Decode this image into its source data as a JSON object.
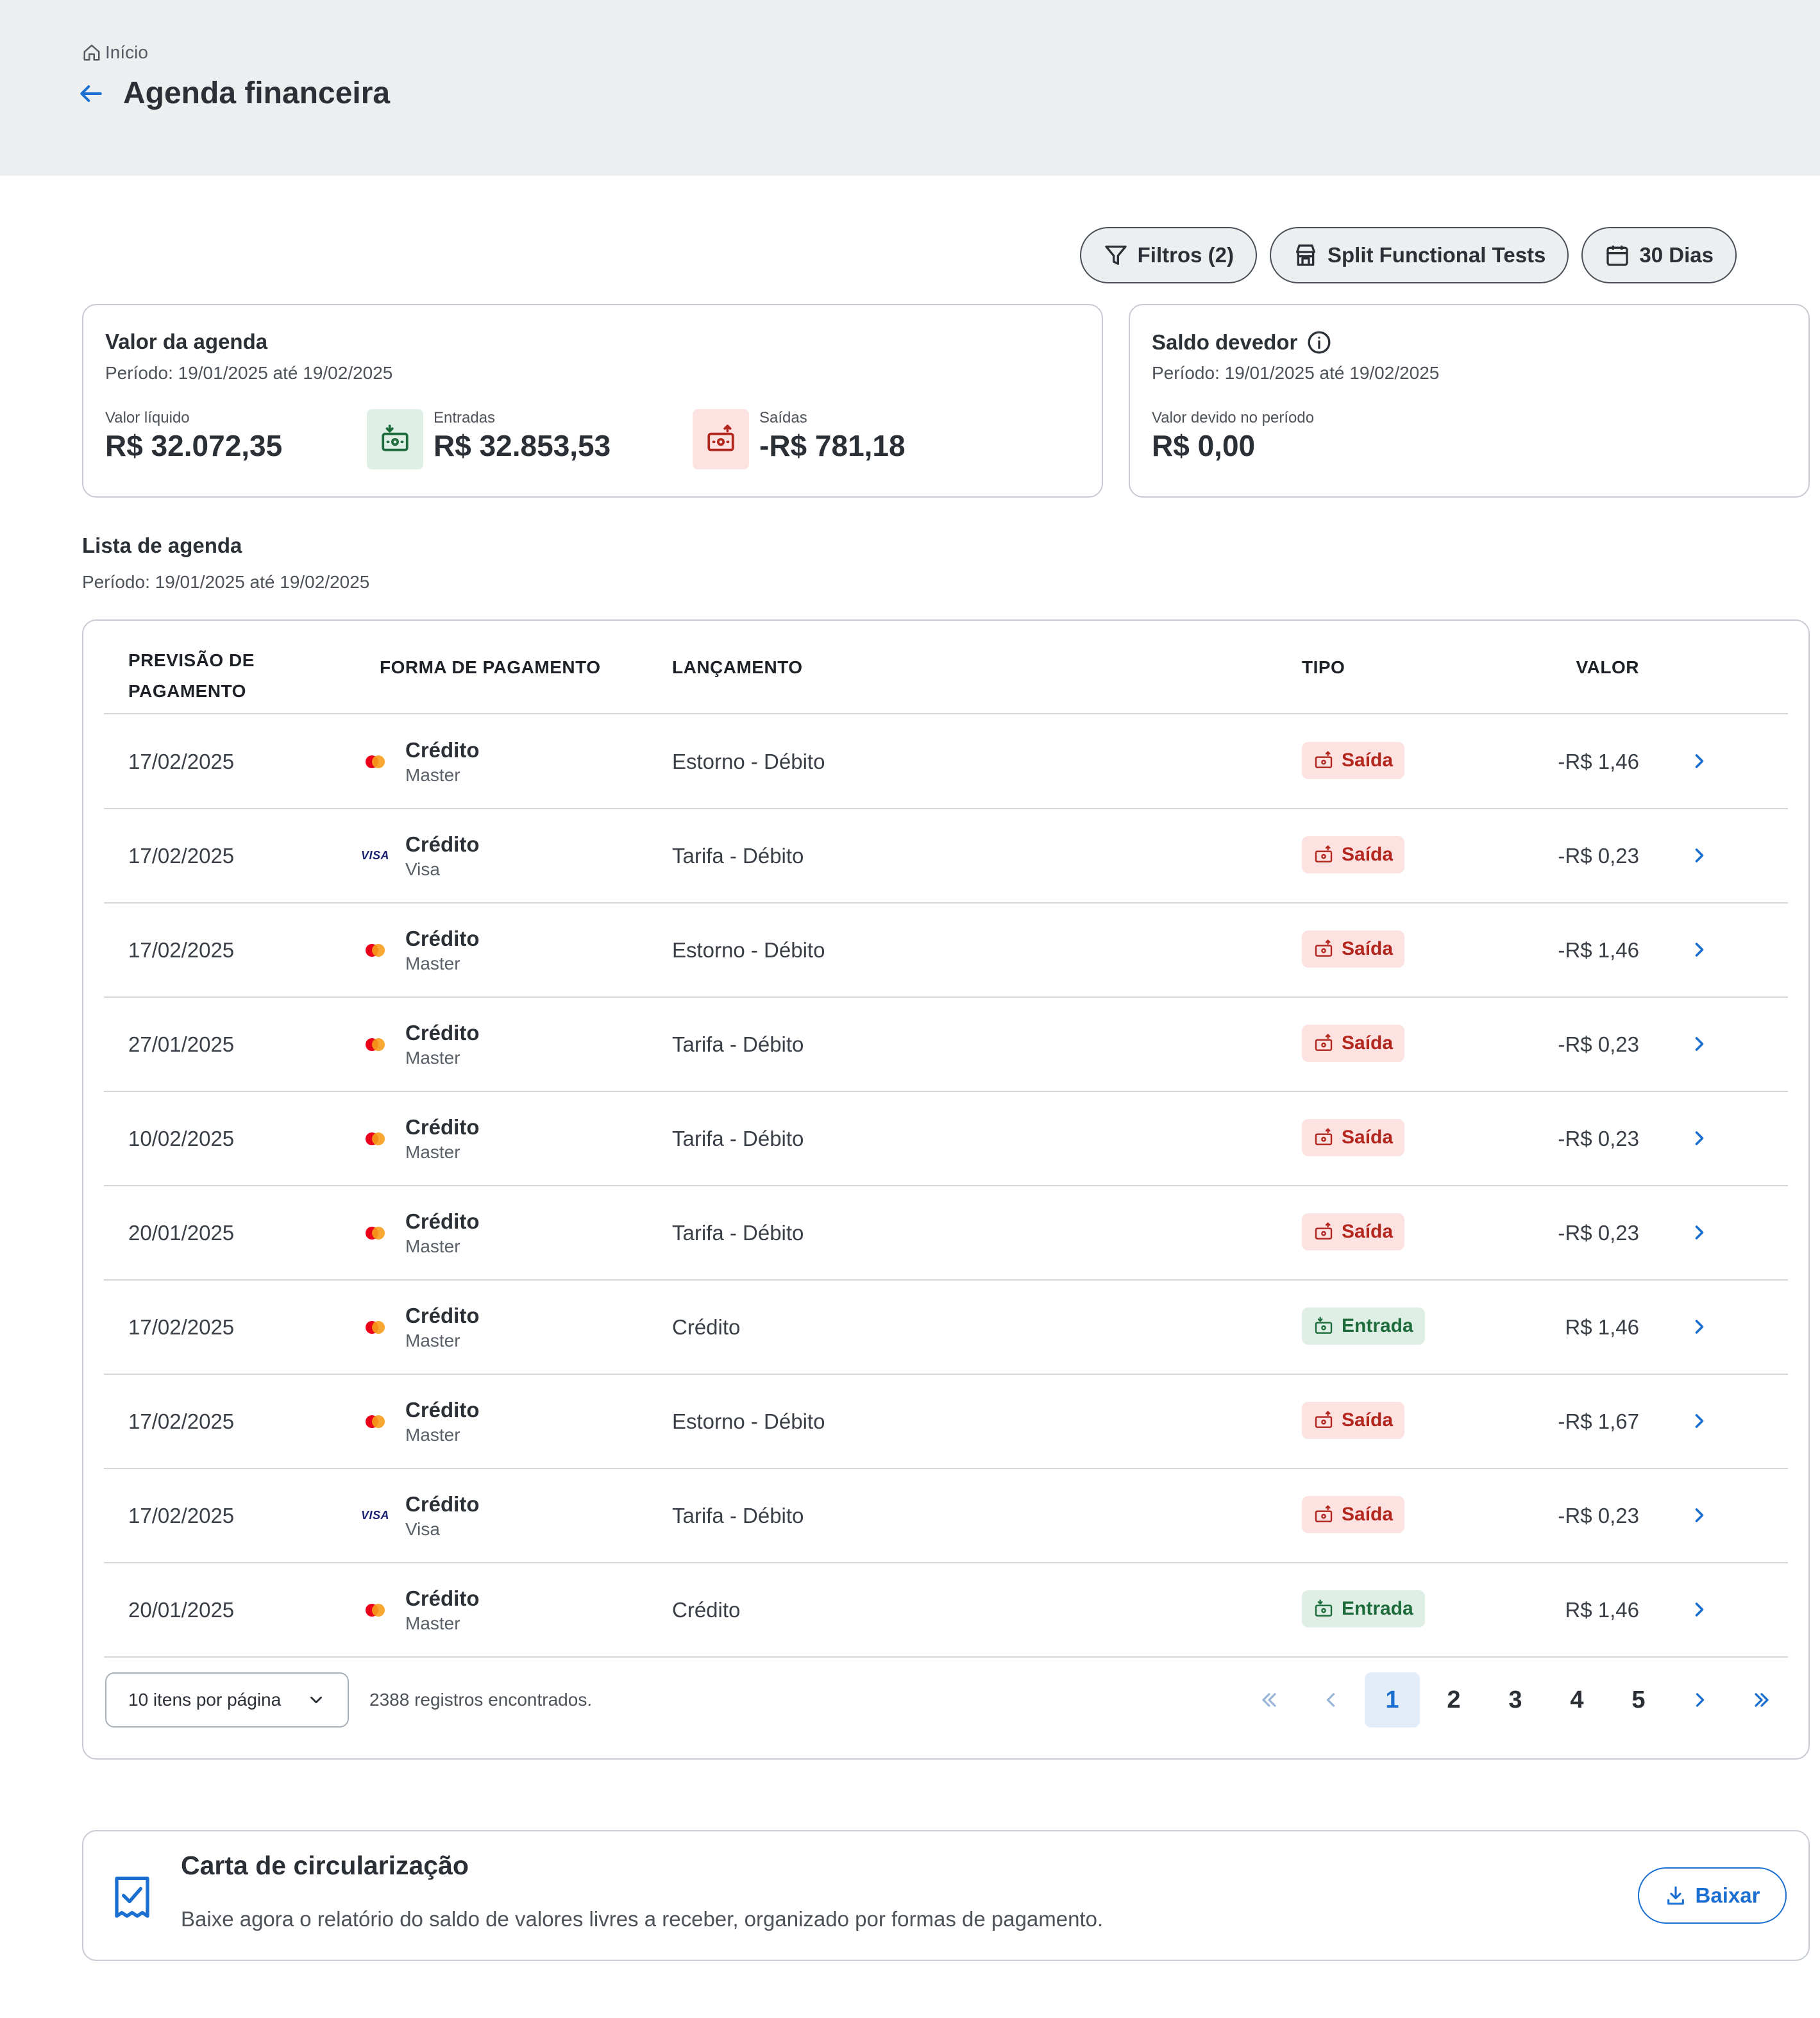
{
  "header": {
    "breadcrumb": "Início",
    "title": "Agenda financeira"
  },
  "toolbar": {
    "filters_label": "Filtros (2)",
    "store_label": "Split Functional Tests",
    "period_label": "30 Dias"
  },
  "agenda_card": {
    "title": "Valor da agenda",
    "period": "Período: 19/01/2025 até 19/02/2025",
    "net_label": "Valor líquido",
    "net_value": "R$ 32.072,35",
    "in_label": "Entradas",
    "in_value": "R$ 32.853,53",
    "out_label": "Saídas",
    "out_value": "-R$ 781,18",
    "in_color": "#e0efe6",
    "out_color": "#fde2e2"
  },
  "saldo_card": {
    "title": "Saldo devedor",
    "period": "Período: 19/01/2025 até 19/02/2025",
    "due_label": "Valor devido no período",
    "due_value": "R$ 0,00"
  },
  "list": {
    "title": "Lista de agenda",
    "period": "Período: 19/01/2025 até 19/02/2025"
  },
  "table": {
    "columns": {
      "date_line1": "PREVISÃO DE",
      "date_line2": "PAGAMENTO",
      "payment": "FORMA DE PAGAMENTO",
      "entry": "LANÇAMENTO",
      "type": "TIPO",
      "value": "VALOR"
    },
    "rows": [
      {
        "date": "17/02/2025",
        "method": "Crédito",
        "brand": "Master",
        "brand_icon": "mastercard-icon",
        "entry": "Estorno - Débito",
        "type": "Saída",
        "kind": "out",
        "value": "-R$ 1,46"
      },
      {
        "date": "17/02/2025",
        "method": "Crédito",
        "brand": "Visa",
        "brand_icon": "visa-icon",
        "entry": "Tarifa - Débito",
        "type": "Saída",
        "kind": "out",
        "value": "-R$ 0,23"
      },
      {
        "date": "17/02/2025",
        "method": "Crédito",
        "brand": "Master",
        "brand_icon": "mastercard-icon",
        "entry": "Estorno - Débito",
        "type": "Saída",
        "kind": "out",
        "value": "-R$ 1,46"
      },
      {
        "date": "27/01/2025",
        "method": "Crédito",
        "brand": "Master",
        "brand_icon": "mastercard-icon",
        "entry": "Tarifa - Débito",
        "type": "Saída",
        "kind": "out",
        "value": "-R$ 0,23"
      },
      {
        "date": "10/02/2025",
        "method": "Crédito",
        "brand": "Master",
        "brand_icon": "mastercard-icon",
        "entry": "Tarifa - Débito",
        "type": "Saída",
        "kind": "out",
        "value": "-R$ 0,23"
      },
      {
        "date": "20/01/2025",
        "method": "Crédito",
        "brand": "Master",
        "brand_icon": "mastercard-icon",
        "entry": "Tarifa - Débito",
        "type": "Saída",
        "kind": "out",
        "value": "-R$ 0,23"
      },
      {
        "date": "17/02/2025",
        "method": "Crédito",
        "brand": "Master",
        "brand_icon": "mastercard-icon",
        "entry": "Crédito",
        "type": "Entrada",
        "kind": "in",
        "value": "R$ 1,46"
      },
      {
        "date": "17/02/2025",
        "method": "Crédito",
        "brand": "Master",
        "brand_icon": "mastercard-icon",
        "entry": "Estorno - Débito",
        "type": "Saída",
        "kind": "out",
        "value": "-R$ 1,67"
      },
      {
        "date": "17/02/2025",
        "method": "Crédito",
        "brand": "Visa",
        "brand_icon": "visa-icon",
        "entry": "Tarifa - Débito",
        "type": "Saída",
        "kind": "out",
        "value": "-R$ 0,23"
      },
      {
        "date": "20/01/2025",
        "method": "Crédito",
        "brand": "Master",
        "brand_icon": "mastercard-icon",
        "entry": "Crédito",
        "type": "Entrada",
        "kind": "in",
        "value": "R$ 1,46"
      }
    ]
  },
  "pagination": {
    "per_page": "10 itens por página",
    "records": "2388 registros encontrados.",
    "pages": [
      "1",
      "2",
      "3",
      "4",
      "5"
    ],
    "current_page": "1"
  },
  "carta": {
    "title": "Carta de circularização",
    "description": "Baixe agora o relatório do saldo de valores livres a receber, organizado por formas de pagamento.",
    "button": "Baixar"
  },
  "colors": {
    "accent": "#1a6fd1",
    "out_text": "#b3261e",
    "in_text": "#1d6b3b"
  }
}
